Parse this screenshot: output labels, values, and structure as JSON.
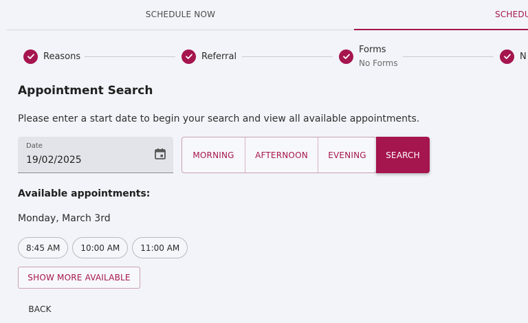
{
  "tabs": [
    {
      "label": "SCHEDULE NOW",
      "active": false
    },
    {
      "label": "SCHEDULE",
      "active": true
    }
  ],
  "stepper": {
    "steps": [
      {
        "label": "Reasons",
        "sub": ""
      },
      {
        "label": "Referral",
        "sub": ""
      },
      {
        "label": "Forms",
        "sub": "No Forms"
      },
      {
        "label": "N",
        "sub": ""
      }
    ]
  },
  "main": {
    "heading": "Appointment Search",
    "intro": "Please enter a start date to begin your search and view all available appointments.",
    "date_field": {
      "label": "Date",
      "value": "19/02/2025"
    },
    "time_filters": [
      "MORNING",
      "AFTERNOON",
      "EVENING"
    ],
    "search_label": "SEARCH",
    "available_heading": "Available appointments:",
    "date_heading": "Monday, March 3rd",
    "slots": [
      "8:45 AM",
      "10:00 AM",
      "11:00 AM"
    ],
    "show_more_label": "SHOW MORE AVAILABLE",
    "back_label": "BACK"
  },
  "colors": {
    "accent": "#a5154e",
    "background": "#f2f4f9"
  },
  "icons": {
    "step": "check-circle-icon",
    "date": "calendar-icon"
  }
}
